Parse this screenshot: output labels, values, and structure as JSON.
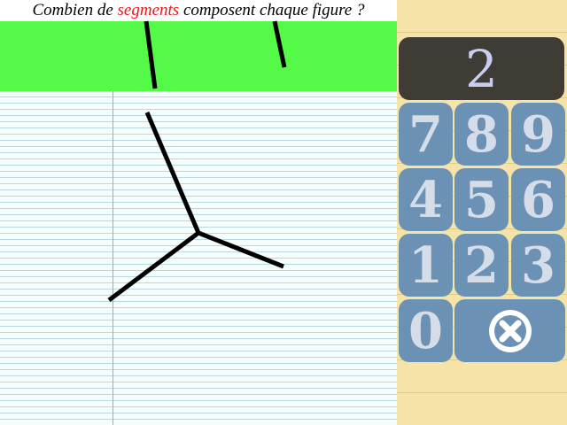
{
  "question": {
    "before": "Combien de",
    "highlight": "segments",
    "after": "composent chaque figure ?"
  },
  "display": {
    "value": "2"
  },
  "keypad": {
    "k7": "7",
    "k8": "8",
    "k9": "9",
    "k4": "4",
    "k5": "5",
    "k6": "6",
    "k1": "1",
    "k2": "2",
    "k3": "3",
    "k0": "0",
    "clear_icon": "close-circle-icon"
  },
  "colors": {
    "highlight": "#e8161a",
    "green_band": "#55f947",
    "display_bg": "#3f3c36",
    "key_bg": "#6b92b5",
    "pad_bg": "#f6e3a8"
  }
}
